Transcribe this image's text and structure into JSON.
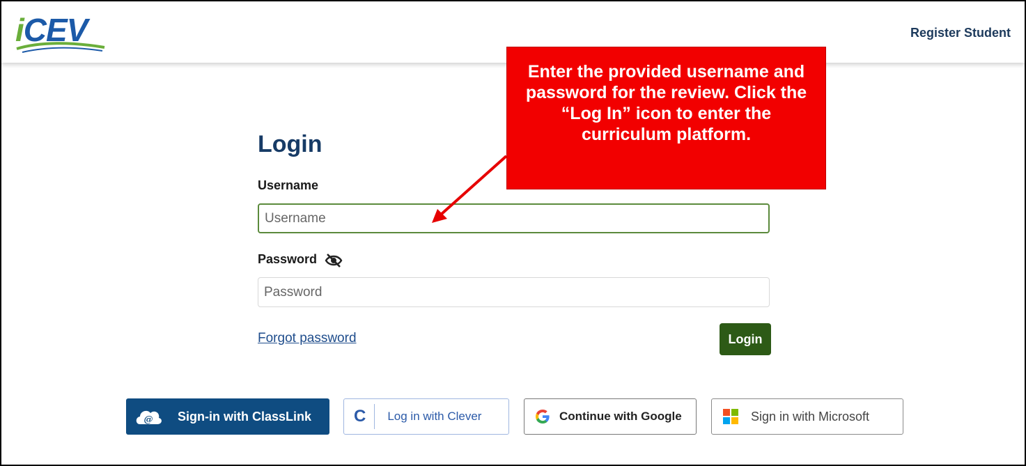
{
  "header": {
    "logo_text": "iCEV",
    "register_label": "Register Student"
  },
  "login": {
    "title": "Login",
    "username_label": "Username",
    "username_placeholder": "Username",
    "password_label": "Password",
    "password_placeholder": "Password",
    "forgot_label": "Forgot password",
    "submit_label": "Login"
  },
  "sso": {
    "classlink_label": "Sign-in with ClassLink",
    "clever_label": "Log in with Clever",
    "clever_letter": "C",
    "google_label": "Continue with Google",
    "microsoft_label": "Sign in with Microsoft"
  },
  "annotation": {
    "text": "Enter the provided username and password for the review. Click the “Log In” icon to enter the curriculum platform."
  },
  "colors": {
    "brand_blue": "#1c5aa8",
    "brand_green": "#6aae3a",
    "login_button": "#2d5a16",
    "callout_red": "#f20000",
    "classlink_blue": "#0f4c81"
  }
}
